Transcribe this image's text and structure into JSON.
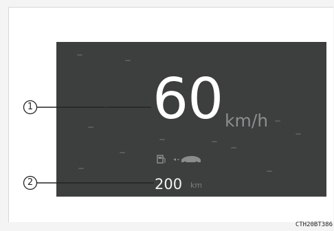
{
  "display": {
    "speed": "60",
    "speed_unit": "km/h",
    "range": "200",
    "range_unit": "km"
  },
  "callouts": [
    {
      "label": "1"
    },
    {
      "label": "2"
    }
  ],
  "figure_code": "CTH20BT386",
  "icons": {
    "fuel": "fuel-pump-icon",
    "range_indicator": "range-indicator-icon"
  },
  "colors": {
    "panel_background": "#3d3e3e",
    "speed_text": "#ffffff",
    "unit_text": "#8c8f8f"
  }
}
